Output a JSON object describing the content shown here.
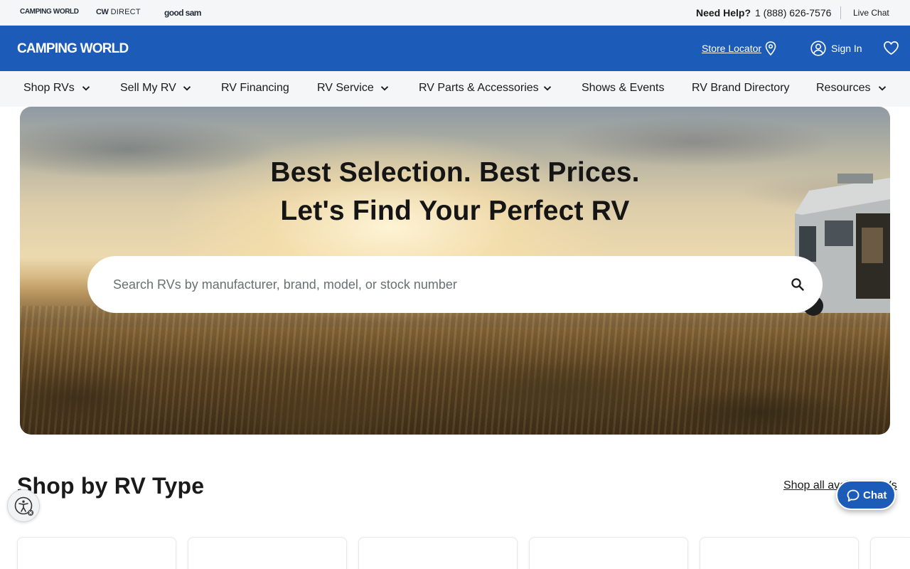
{
  "utility": {
    "brands": [
      "CAMPING WORLD",
      "DIRECT",
      "good sam"
    ],
    "brand_cw_prefix": "CW",
    "need_help": "Need Help?",
    "phone": "1 (888) 626-7576",
    "live_chat": "Live Chat"
  },
  "header": {
    "logo": "CAMPING WORLD",
    "store_locator": "Store Locator",
    "sign_in": "Sign In"
  },
  "nav": {
    "items": [
      {
        "label": "Shop RVs",
        "dropdown": true
      },
      {
        "label": "Sell My RV",
        "dropdown": true
      },
      {
        "label": "RV Financing",
        "dropdown": false
      },
      {
        "label": "RV Service",
        "dropdown": true
      },
      {
        "label": "RV Parts & Accessories",
        "dropdown": true
      },
      {
        "label": "Shows & Events",
        "dropdown": false
      },
      {
        "label": "RV Brand Directory",
        "dropdown": false
      },
      {
        "label": "Resources",
        "dropdown": true
      }
    ]
  },
  "hero": {
    "title_line1": "Best Selection. Best Prices.",
    "title_line2": "Let's Find Your Perfect RV",
    "search_placeholder": "Search RVs by manufacturer, brand, model, or stock number"
  },
  "section": {
    "title": "Shop by RV Type",
    "shop_all": "Shop all available RVs"
  },
  "chat": {
    "label": "Chat"
  },
  "colors": {
    "brand_blue": "#1d5bb9",
    "utility_bg": "#f5f6f7"
  }
}
